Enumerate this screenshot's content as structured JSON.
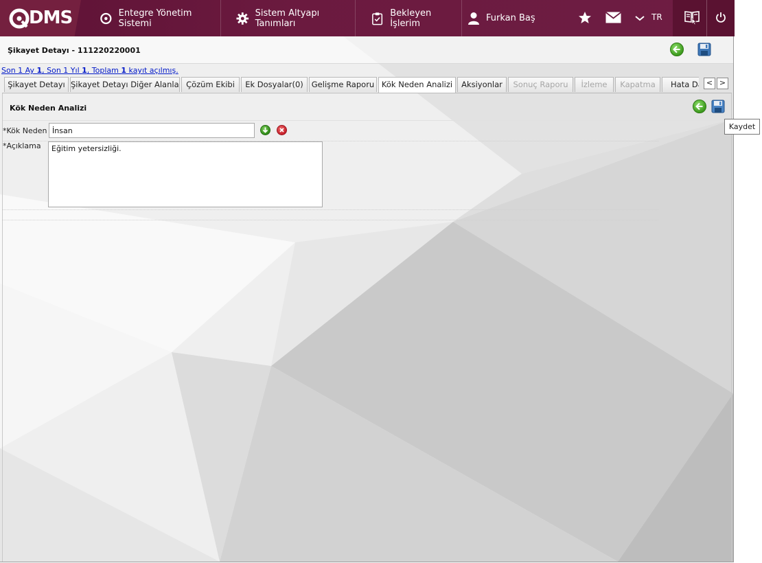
{
  "header": {
    "logo_text": "DMS",
    "nav": [
      {
        "label": "Entegre Yönetim Sistemi",
        "icon": "q-logo-icon"
      },
      {
        "label": "Sistem Altyapı Tanımları",
        "icon": "gear-icon"
      },
      {
        "label": "Bekleyen İşlerim",
        "icon": "clipboard-check-icon"
      },
      {
        "label": "Furkan Baş",
        "icon": "user-icon"
      }
    ],
    "language": "TR",
    "icons": [
      "star-icon",
      "mail-icon",
      "chevron-down-icon",
      "book-help-icon",
      "power-icon"
    ]
  },
  "page": {
    "title": "Şikayet Detayı - 111220220001",
    "summary": {
      "p1": "Son 1 Ay ",
      "month_count": "1",
      "p2": ", Son 1 Yıl ",
      "year_count": "1",
      "p3": ", Toplam ",
      "total_count": "1",
      "p4": " kayıt açılmış."
    }
  },
  "tabs": [
    {
      "label": "Şikayet Detayı",
      "state": "normal"
    },
    {
      "label": "Şikayet Detayı Diğer Alanlar",
      "state": "normal"
    },
    {
      "label": "Çözüm Ekibi",
      "state": "normal"
    },
    {
      "label": "Ek Dosyalar(0)",
      "state": "normal"
    },
    {
      "label": "Gelişme Raporu",
      "state": "normal"
    },
    {
      "label": "Kök Neden Analizi",
      "state": "active"
    },
    {
      "label": "Aksiyonlar",
      "state": "normal"
    },
    {
      "label": "Sonuç Raporu",
      "state": "disabled"
    },
    {
      "label": "İzleme",
      "state": "disabled"
    },
    {
      "label": "Kapatma",
      "state": "disabled"
    },
    {
      "label": "Hata Dağılımı",
      "state": "normal"
    }
  ],
  "tab_scroll": {
    "left": "<",
    "right": ">"
  },
  "panel": {
    "title": "Kök Neden Analizi",
    "fields": {
      "root_cause_label": "*Kök Neden",
      "root_cause_value": "İnsan",
      "description_label": "*Açıklama",
      "description_value": "Eğitim yetersizliği."
    }
  },
  "tooltip": "Kaydet",
  "colors": {
    "header_bg": "#6b1a3f",
    "link": "#0018c8",
    "go_green": "#3d9a1e",
    "delete_red": "#c6202b"
  }
}
